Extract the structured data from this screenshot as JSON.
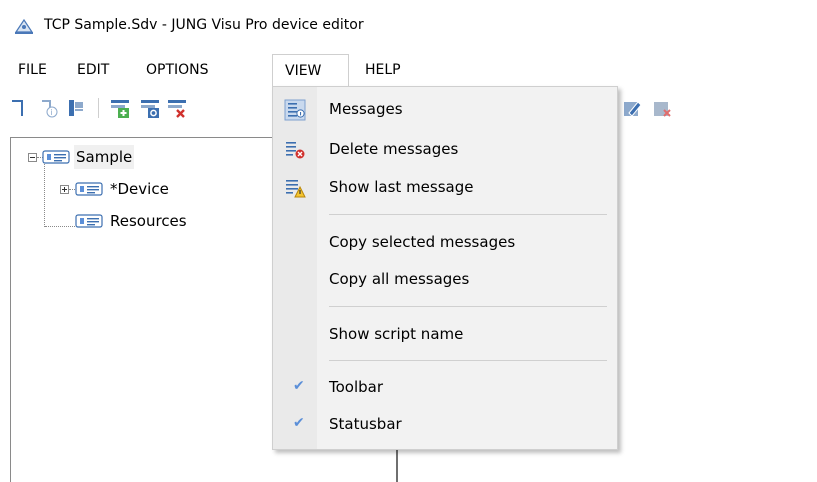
{
  "window": {
    "title": "TCP Sample.Sdv - JUNG Visu Pro device editor"
  },
  "menubar": {
    "items": [
      "FILE",
      "EDIT",
      "OPTIONS",
      "VIEW",
      "HELP"
    ],
    "active": "VIEW"
  },
  "tree": {
    "root": "Sample",
    "children": [
      "*Device",
      "Resources"
    ]
  },
  "view_menu": {
    "items": [
      {
        "label": "Messages",
        "icon": "messages-icon"
      },
      {
        "label": "Delete messages",
        "icon": "delete-messages-icon"
      },
      {
        "label": "Show last message",
        "icon": "warning-message-icon"
      },
      {
        "label": "Copy selected messages"
      },
      {
        "label": "Copy all messages"
      },
      {
        "label": "Show script name"
      },
      {
        "label": "Toolbar",
        "checked": true
      },
      {
        "label": "Statusbar",
        "checked": true
      }
    ]
  },
  "colors": {
    "accent": "#5b8fd8",
    "menu_bg": "#f2f2f2",
    "selection": "#f0f0f0"
  }
}
